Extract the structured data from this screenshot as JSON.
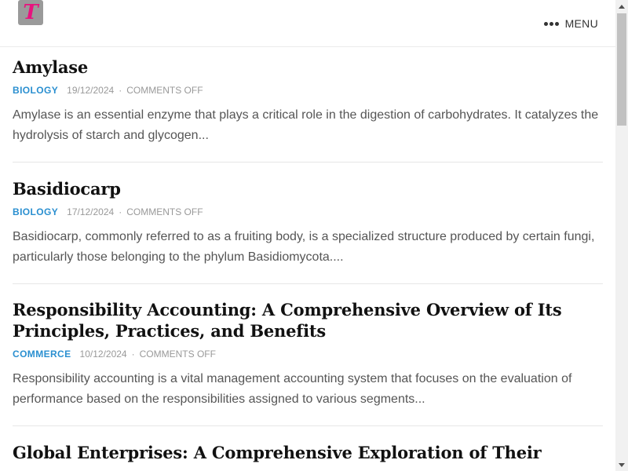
{
  "header": {
    "logo_letter": "T",
    "menu_label": "MENU"
  },
  "colors": {
    "accent": "#2a8fd0",
    "logo_letter": "#e8137e",
    "logo_bg": "#9a9a9a"
  },
  "posts": [
    {
      "title": "Amylase",
      "category": "BIOLOGY",
      "date": "19/12/2024",
      "comments": "COMMENTS OFF",
      "excerpt": "Amylase is an essential enzyme that plays a critical role in the digestion of carbohydrates. It catalyzes the hydrolysis of starch and glycogen..."
    },
    {
      "title": "Basidiocarp",
      "category": "BIOLOGY",
      "date": "17/12/2024",
      "comments": "COMMENTS OFF",
      "excerpt": "Basidiocarp, commonly referred to as a fruiting body, is a specialized structure produced by certain fungi, particularly those belonging to the phylum Basidiomycota...."
    },
    {
      "title": "Responsibility Accounting: A Comprehensive Overview of Its Principles, Practices, and Benefits",
      "category": "COMMERCE",
      "date": "10/12/2024",
      "comments": "COMMENTS OFF",
      "excerpt": "Responsibility accounting is a vital management accounting system that focuses on the evaluation of performance based on the responsibilities assigned to various segments..."
    },
    {
      "title": "Global Enterprises: A Comprehensive Exploration of Their"
    }
  ],
  "separator": "·"
}
